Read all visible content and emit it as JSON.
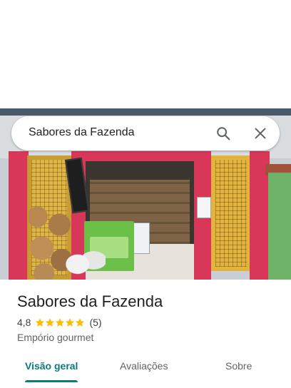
{
  "search": {
    "query": "Sabores da Fazenda"
  },
  "place": {
    "name": "Sabores da Fazenda",
    "rating": "4,8",
    "stars": 5,
    "review_count": "(5)",
    "category": "Empório gourmet"
  },
  "tabs": [
    {
      "label": "Visão geral",
      "active": true
    },
    {
      "label": "Avaliações",
      "active": false
    },
    {
      "label": "Sobre",
      "active": false
    }
  ],
  "colors": {
    "accent": "#0b7a7a",
    "star": "#fbbc04",
    "storefront": "#d8375a"
  },
  "icons": [
    "search-icon",
    "close-icon",
    "star-icon"
  ]
}
